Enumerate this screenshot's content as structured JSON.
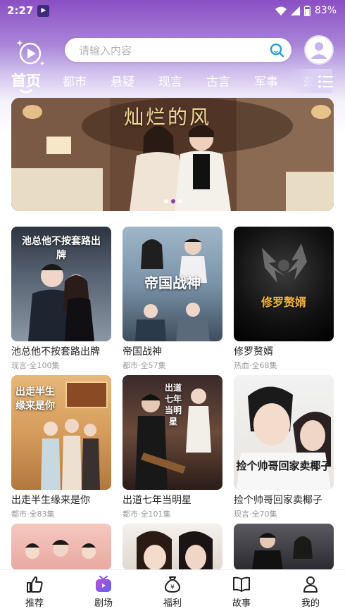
{
  "status_bar": {
    "time": "2:27",
    "battery": "83%"
  },
  "search": {
    "placeholder": "请输入内容"
  },
  "tabs": [
    "首页",
    "都市",
    "悬疑",
    "现言",
    "古言",
    "军事",
    "玄"
  ],
  "banner": {
    "title": "灿烂的风",
    "page_count": 3,
    "active_page": 2
  },
  "grid": [
    {
      "title": "池总他不按套路出牌",
      "meta": "现言·全100集",
      "poster_text": "池总他不按套路出牌"
    },
    {
      "title": "帝国战神",
      "meta": "都市·全57集",
      "poster_text": "帝国战神"
    },
    {
      "title": "修罗赘婿",
      "meta": "热血·全68集",
      "poster_text": "修罗赘婿"
    },
    {
      "title": "出走半生缘来是你",
      "meta": "都市·全83集",
      "poster_text": "出走半生缘来是你"
    },
    {
      "title": "出道七年当明星",
      "meta": "都市·全101集",
      "poster_text": "出道七年当明星"
    },
    {
      "title": "捡个帅哥回家卖椰子",
      "meta": "现言·全70集",
      "poster_text": "捡个帅哥回家卖椰子"
    }
  ],
  "bottom_nav": [
    {
      "label": "推荐",
      "icon": "thumbs-up-icon"
    },
    {
      "label": "剧场",
      "icon": "tv-icon",
      "active": true
    },
    {
      "label": "福利",
      "icon": "money-bag-icon"
    },
    {
      "label": "故事",
      "icon": "book-icon"
    },
    {
      "label": "我的",
      "icon": "person-icon"
    }
  ],
  "colors": {
    "accent": "#8a4fc4",
    "search_icon": "#2a9bd6",
    "active_nav": "#7a4fd8"
  }
}
